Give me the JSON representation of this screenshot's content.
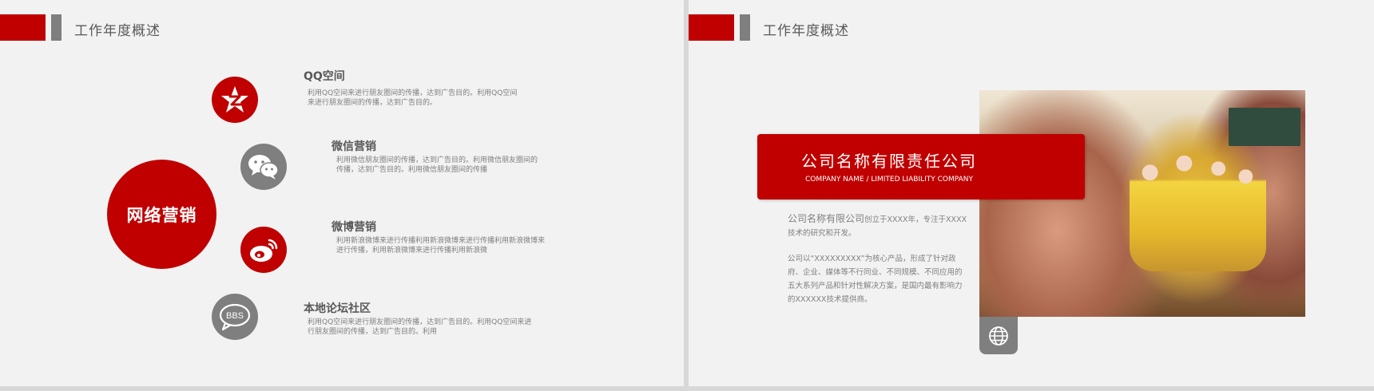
{
  "left_slide": {
    "header_title": "工作年度概述",
    "center_label": "网络营销",
    "items": [
      {
        "title": "QQ空间",
        "icon": "qzone-star-icon",
        "desc_lines": [
          "利用QQ空间来进行朋友圈间的传播，达到广告目的。利用QQ空间",
          "来进行朋友圈间的传播，达到广告目的。"
        ]
      },
      {
        "title": "微信营销",
        "icon": "wechat-icon",
        "desc_lines": [
          "利用微信朋友圈间的传播，达到广告目的。利用微信朋友圈间的",
          "传播，达到广告目的。利用微信朋友圈间的传播"
        ]
      },
      {
        "title": "微博营销",
        "icon": "weibo-icon",
        "desc_lines": [
          "利用新浪微博来进行传播利用新浪微博来进行传播利用新浪微博来",
          "进行传播，利用新浪微博来进行传播利用新浪微"
        ]
      },
      {
        "title": "本地论坛社区",
        "icon": "bbs-icon",
        "icon_text": "BBS",
        "desc_lines": [
          "利用QQ空间来进行朋友圈间的传播，达到广告目的。利用QQ空间来进",
          "行朋友圈间的传播，达到广告目的。利用"
        ]
      }
    ],
    "colors": {
      "accent": "#c00000",
      "gray": "#7f7f7f",
      "background": "#f2f2f2"
    }
  },
  "right_slide": {
    "header_title": "工作年度概述",
    "banner": {
      "title": "公司名称有限责任公司",
      "subtitle": "COMPANY NAME / LIMITED LIABILITY COMPANY"
    },
    "paragraph1": {
      "lead": "公司名称有限公司",
      "rest_line1": "创立于XXXX年，专注于XXXX",
      "line2": "技术的研究和开发。"
    },
    "paragraph2_lines": [
      "公司以“XXXXXXXXX”为核心产品，形成了针对政",
      "府、企业、媒体等不行同业、不同规模、不同应用的",
      "五大系列产品和针对性解决方案，是国内最有影响力",
      "的XXXXXX技术提供商。"
    ],
    "globe_icon": "globe-icon",
    "photo": "students-photo-framed-by-hands"
  }
}
